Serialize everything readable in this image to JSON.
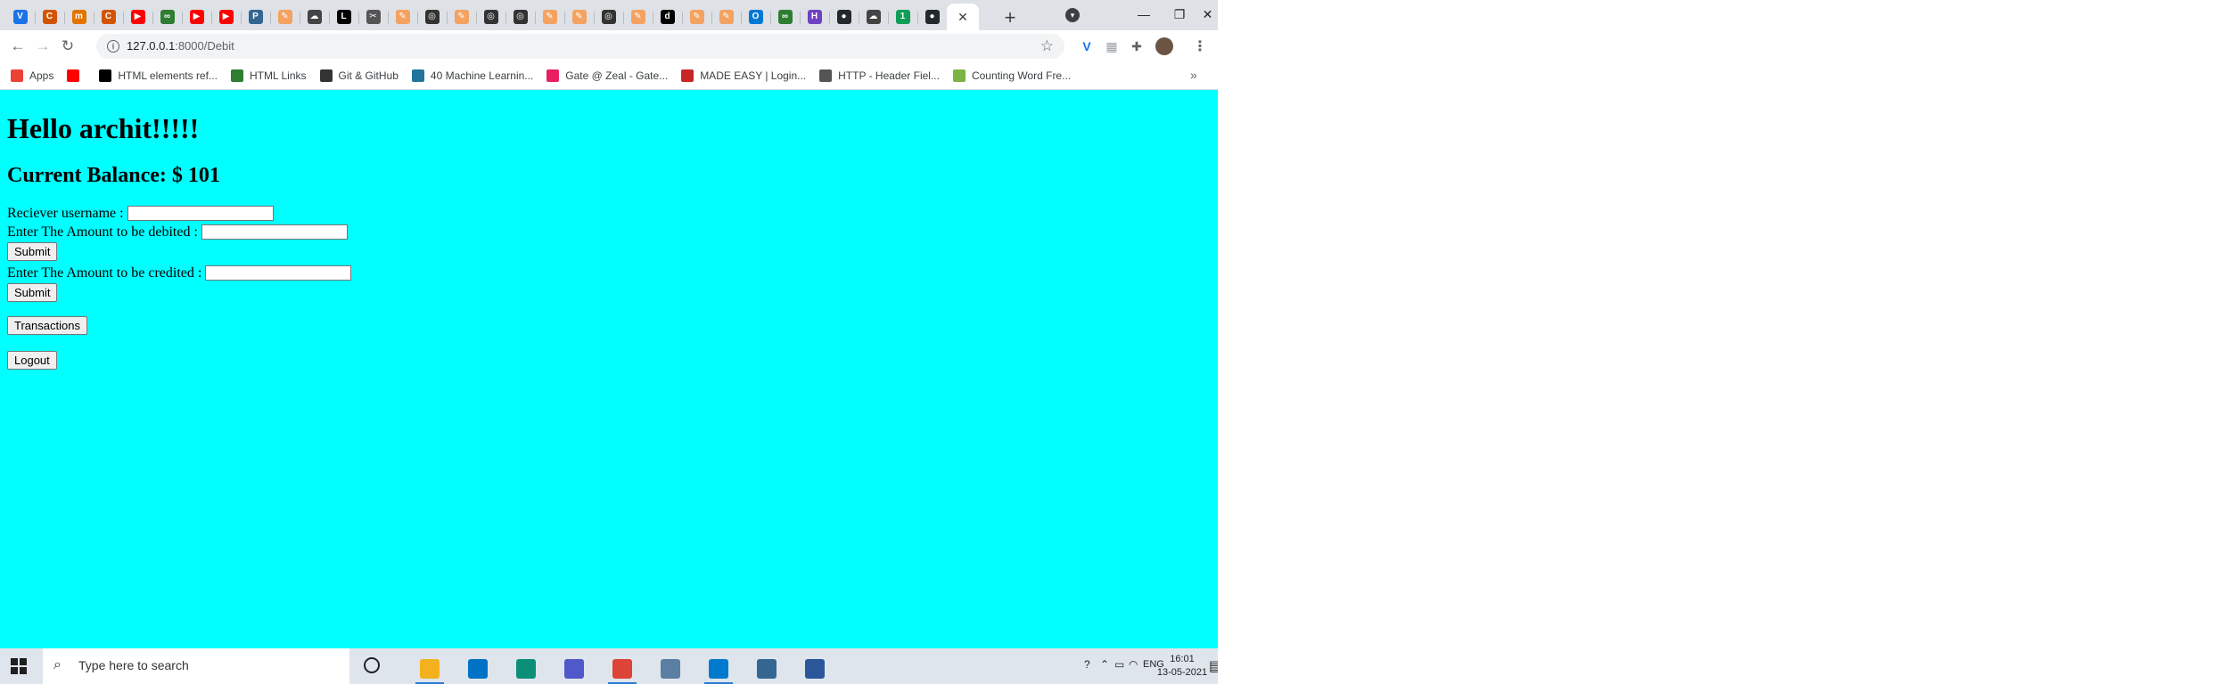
{
  "browser": {
    "tabs": [
      {
        "icon": "v-icon",
        "glyph": "V",
        "color": "#1a73e8"
      },
      {
        "icon": "c-curve-icon",
        "glyph": "C",
        "color": "#d35400"
      },
      {
        "icon": "m-icon",
        "glyph": "m",
        "color": "#e37400"
      },
      {
        "icon": "c-curve-icon",
        "glyph": "C",
        "color": "#d35400"
      },
      {
        "icon": "youtube-icon",
        "glyph": "▶",
        "color": "#ff0000"
      },
      {
        "icon": "link-icon",
        "glyph": "∞",
        "color": "#2e7d32"
      },
      {
        "icon": "youtube-icon",
        "glyph": "▶",
        "color": "#ff0000"
      },
      {
        "icon": "youtube-icon",
        "glyph": "▶",
        "color": "#ff0000"
      },
      {
        "icon": "postgres-icon",
        "glyph": "P",
        "color": "#336791"
      },
      {
        "icon": "pen-icon",
        "glyph": "✎",
        "color": "#f4a261"
      },
      {
        "icon": "cloud-icon",
        "glyph": "☁",
        "color": "#444444"
      },
      {
        "icon": "l-icon",
        "glyph": "L",
        "color": "#000000"
      },
      {
        "icon": "scissors-icon",
        "glyph": "✂",
        "color": "#555555"
      },
      {
        "icon": "pen-icon",
        "glyph": "✎",
        "color": "#f4a261"
      },
      {
        "icon": "globe-icon",
        "glyph": "◎",
        "color": "#333333"
      },
      {
        "icon": "pen-icon",
        "glyph": "✎",
        "color": "#f4a261"
      },
      {
        "icon": "globe-icon",
        "glyph": "◎",
        "color": "#333333"
      },
      {
        "icon": "globe-icon",
        "glyph": "◎",
        "color": "#333333"
      },
      {
        "icon": "pen-icon",
        "glyph": "✎",
        "color": "#f4a261"
      },
      {
        "icon": "pen-icon",
        "glyph": "✎",
        "color": "#f4a261"
      },
      {
        "icon": "globe-icon",
        "glyph": "◎",
        "color": "#333333"
      },
      {
        "icon": "pen-icon",
        "glyph": "✎",
        "color": "#f4a261"
      },
      {
        "icon": "d-icon",
        "glyph": "d",
        "color": "#000000"
      },
      {
        "icon": "pen-icon",
        "glyph": "✎",
        "color": "#f4a261"
      },
      {
        "icon": "pen-icon",
        "glyph": "✎",
        "color": "#f4a261"
      },
      {
        "icon": "outlook-icon",
        "glyph": "O",
        "color": "#0078d4"
      },
      {
        "icon": "link-icon",
        "glyph": "∞",
        "color": "#2e7d32"
      },
      {
        "icon": "h-icon",
        "glyph": "H",
        "color": "#6f42c1"
      },
      {
        "icon": "github-icon",
        "glyph": "●",
        "color": "#24292e"
      },
      {
        "icon": "cloud-icon",
        "glyph": "☁",
        "color": "#444444"
      },
      {
        "icon": "number-one-icon",
        "glyph": "1",
        "color": "#0f9d58"
      },
      {
        "icon": "github-icon",
        "glyph": "●",
        "color": "#24292e"
      }
    ],
    "active_tab_close": "✕",
    "new_tab": "+",
    "url_host": "127.0.0.1",
    "url_path": ":8000/Debit",
    "bookmarks": [
      {
        "label": "Apps",
        "icon": "apps-grid-icon",
        "color": "#ea4335"
      },
      {
        "label": "",
        "icon": "youtube-icon",
        "color": "#ff0000"
      },
      {
        "label": "HTML elements ref...",
        "icon": "bookmark-page-icon",
        "color": "#000000"
      },
      {
        "label": "HTML Links",
        "icon": "w-icon",
        "color": "#2e7d32"
      },
      {
        "label": "Git & GitHub",
        "icon": "globe-icon",
        "color": "#333333"
      },
      {
        "label": "40 Machine Learnin...",
        "icon": "wordpress-icon",
        "color": "#21759b"
      },
      {
        "label": "Gate @ Zeal - Gate...",
        "icon": "gate-icon",
        "color": "#e91e63"
      },
      {
        "label": "MADE EASY | Login...",
        "icon": "madeeasy-icon",
        "color": "#c62828"
      },
      {
        "label": "HTTP - Header Fiel...",
        "icon": "diamond-icon",
        "color": "#555555"
      },
      {
        "label": "Counting Word Fre...",
        "icon": "leaf-icon",
        "color": "#7cb342"
      }
    ]
  },
  "page": {
    "greeting": "Hello archit!!!!!",
    "balance": "Current Balance: $ 101",
    "receiver_label": "Reciever username :",
    "debit_label": "Enter The Amount to be debited :",
    "credit_label": "Enter The Amount to be credited :",
    "submit_label": "Submit",
    "transactions_label": "Transactions",
    "logout_label": "Logout",
    "background": "#00ffff"
  },
  "taskbar": {
    "search_placeholder": "Type here to search",
    "language": "ENG",
    "time": "16:01",
    "date": "13-05-2021",
    "apps": [
      {
        "icon": "file-explorer-icon",
        "color": "#f3b21d",
        "running": true
      },
      {
        "icon": "mail-icon",
        "color": "#0072c6",
        "running": false
      },
      {
        "icon": "edge-icon",
        "color": "#0c8f78",
        "running": false
      },
      {
        "icon": "teams-icon",
        "color": "#5059c9",
        "running": false
      },
      {
        "icon": "chrome-icon",
        "color": "#db4437",
        "running": true
      },
      {
        "icon": "notepad-icon",
        "color": "#5b7fa3",
        "running": false
      },
      {
        "icon": "vscode-icon",
        "color": "#007acc",
        "running": true
      },
      {
        "icon": "pgadmin-icon",
        "color": "#336791",
        "running": false
      },
      {
        "icon": "calendar-app-icon",
        "color": "#2b579a",
        "running": false
      }
    ]
  }
}
